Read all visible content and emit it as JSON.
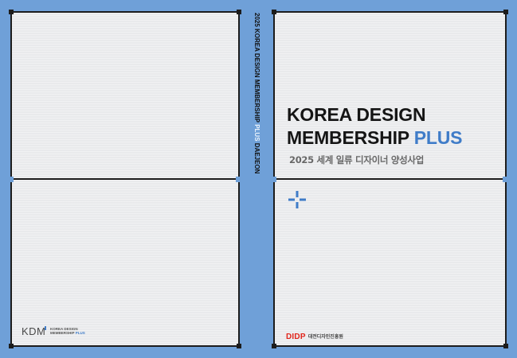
{
  "front_cover": {
    "title_line1": "KOREA DESIGN",
    "title_line2_main": "MEMBERSHIP",
    "title_line2_accent": "PLUS",
    "subtitle": "2025 세계 일류 디자이너 양성사업",
    "publisher": {
      "mark": "DIDP",
      "name": "대전디자인진흥원",
      "mark_color": "#e1251b"
    }
  },
  "spine": {
    "text_main": "2025 KOREA DESIGN MEMBERSHIP",
    "text_accent": "PLUS",
    "text_end": "DAEJEON"
  },
  "back_cover": {
    "logo": {
      "mark": "KDM",
      "sub_line1": "KOREA DESIGN",
      "sub_line2": "MEMBERSHIP",
      "sub_accent": "PLUS"
    }
  },
  "colors": {
    "background": "#6fa0d8",
    "panel": "#e9eaec",
    "accent": "#3f7cc8",
    "frame": "#1c1c1c"
  },
  "icons": [
    "plus-icon"
  ]
}
